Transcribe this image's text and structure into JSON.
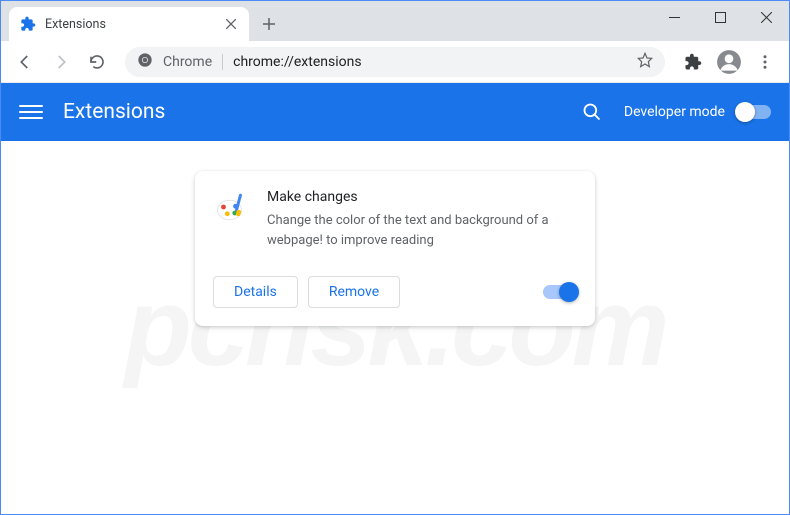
{
  "window": {
    "controls": {
      "minimize": "minimize",
      "maximize": "maximize",
      "close": "close"
    }
  },
  "tab": {
    "title": "Extensions",
    "icon": "puzzle-piece-icon"
  },
  "toolbar": {
    "back": "back",
    "forward": "forward",
    "reload": "reload",
    "omnibox": {
      "scheme_label": "Chrome",
      "url": "chrome://extensions"
    }
  },
  "header": {
    "title": "Extensions",
    "dev_mode_label": "Developer mode",
    "dev_mode_on": false
  },
  "extension": {
    "name": "Make changes",
    "description": "Change the color of the text and background of a webpage! to improve reading",
    "buttons": {
      "details": "Details",
      "remove": "Remove"
    },
    "enabled": true
  },
  "watermark": "pcrisk.com"
}
